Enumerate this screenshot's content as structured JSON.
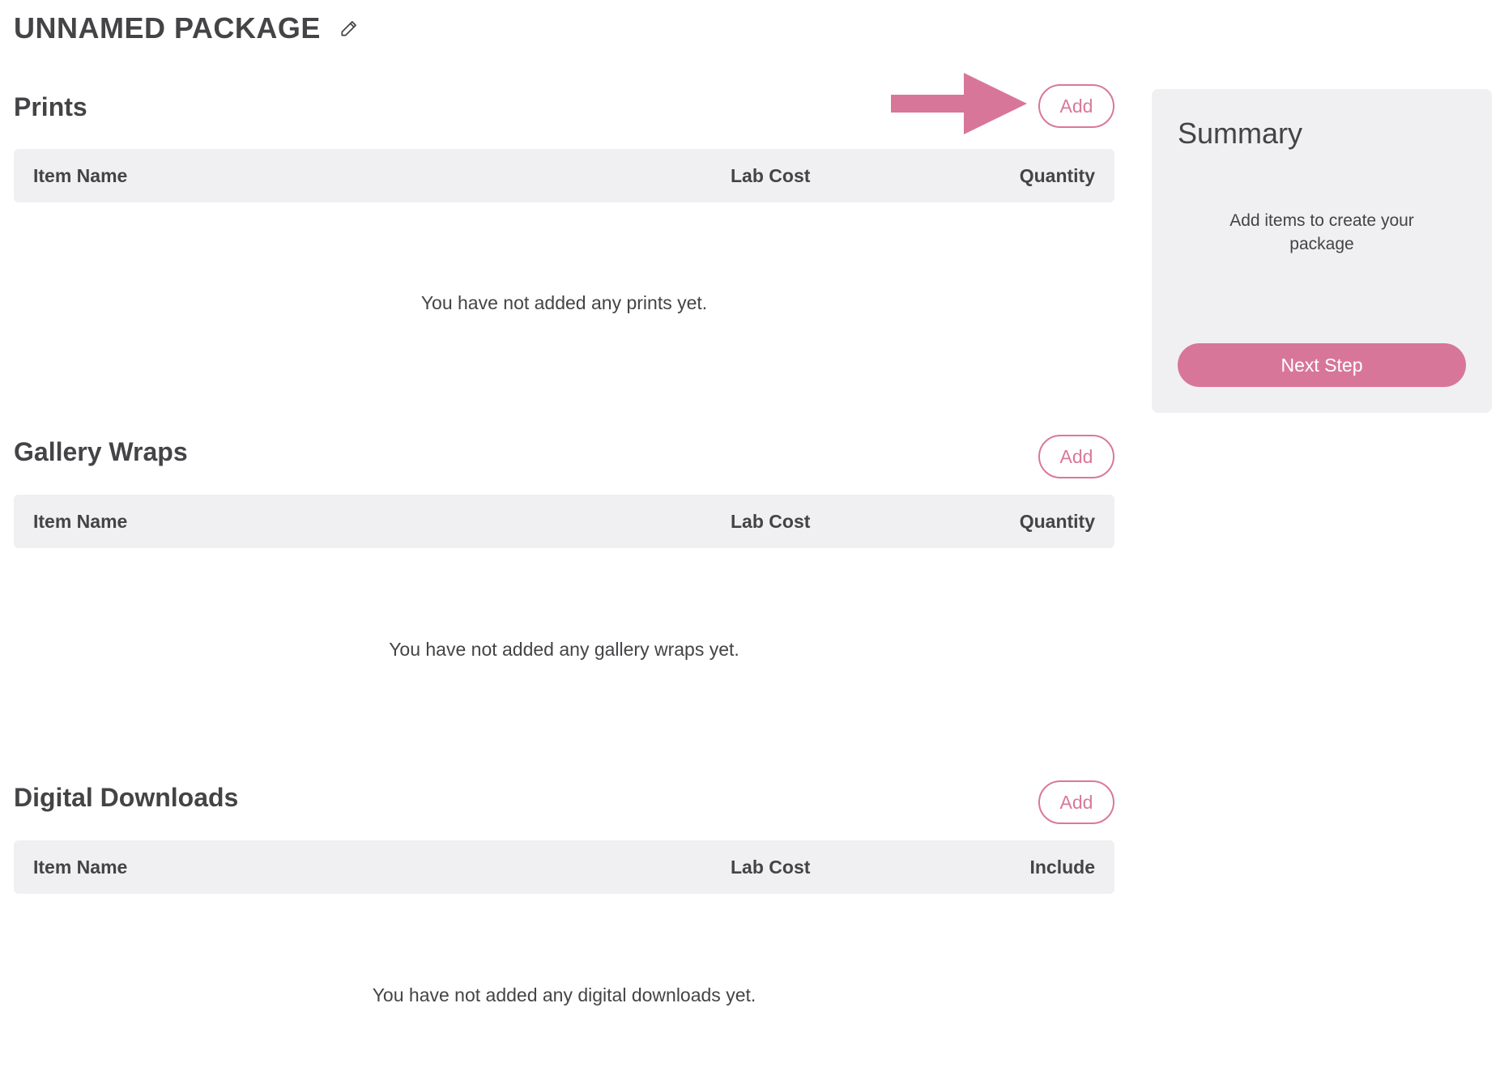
{
  "page": {
    "title": "UNNAMED PACKAGE",
    "edit_icon": "pencil-icon"
  },
  "colors": {
    "accent": "#d9789a",
    "panel_bg": "#f0f0f2",
    "text": "#444447"
  },
  "sections": [
    {
      "title": "Prints",
      "add_label": "Add",
      "columns": [
        "Item Name",
        "Lab Cost",
        "Quantity"
      ],
      "empty_message": "You have not added any prints yet."
    },
    {
      "title": "Gallery Wraps",
      "add_label": "Add",
      "columns": [
        "Item Name",
        "Lab Cost",
        "Quantity"
      ],
      "empty_message": "You have not added any gallery wraps yet."
    },
    {
      "title": "Digital Downloads",
      "add_label": "Add",
      "columns": [
        "Item Name",
        "Lab Cost",
        "Include"
      ],
      "empty_message": "You have not added any digital downloads yet."
    }
  ],
  "summary": {
    "title": "Summary",
    "message": "Add items to create your package",
    "next_label": "Next Step"
  },
  "annotation": {
    "icon": "arrow-right-icon"
  }
}
